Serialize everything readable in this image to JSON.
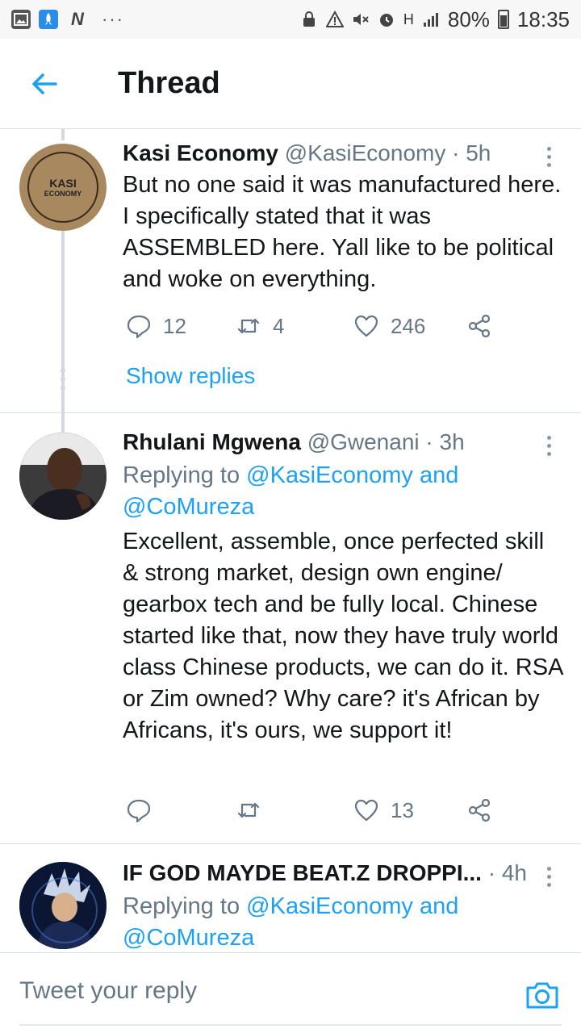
{
  "status_bar": {
    "battery": "80%",
    "time": "18:35",
    "dots": "···",
    "network": "H"
  },
  "header": {
    "title": "Thread"
  },
  "tweets": [
    {
      "name": "Kasi Economy",
      "handle": "@KasiEconomy",
      "time": "· 5h",
      "avatar_text_1": "KASI",
      "avatar_text_2": "ECONOMY",
      "text": "But no one said it was manufactured here. I specifically stated that it was ASSEMBLED here. Yall like to be political and woke on everything.",
      "replies": "12",
      "retweets": "4",
      "likes": "246",
      "show_replies": "Show replies"
    },
    {
      "name": "Rhulani Mgwena",
      "handle": "@Gwenani",
      "time": "· 3h",
      "replying_prefix": "Replying to ",
      "replying_to_1": "@KasiEconomy",
      "replying_and": " and",
      "replying_to_2": "@CoMureza",
      "text": "Excellent, assemble, once perfected skill & strong market, design own engine/ gearbox tech and be fully local. Chinese started like that, now they have truly world class Chinese products, we can do it. RSA or Zim owned? Why care? it's African by Africans, it's ours, we support it!",
      "likes": "13"
    },
    {
      "name": "IF GOD MAYDE BEAT.Z DROPPI...",
      "time": "· 4h",
      "replying_prefix": "Replying to ",
      "replying_to_1": "@KasiEconomy",
      "replying_and": " and",
      "replying_to_2": "@CoMureza"
    }
  ],
  "reply_bar": {
    "placeholder": "Tweet your reply"
  },
  "colors": {
    "accent": "#1da1f2",
    "secondary_text": "#657786",
    "border": "#d6dde2",
    "kasi_avatar_bg": "#a8885e"
  },
  "icons": [
    "back-arrow-icon",
    "more-icon",
    "reply-icon",
    "retweet-icon",
    "like-icon",
    "share-icon",
    "camera-icon"
  ]
}
